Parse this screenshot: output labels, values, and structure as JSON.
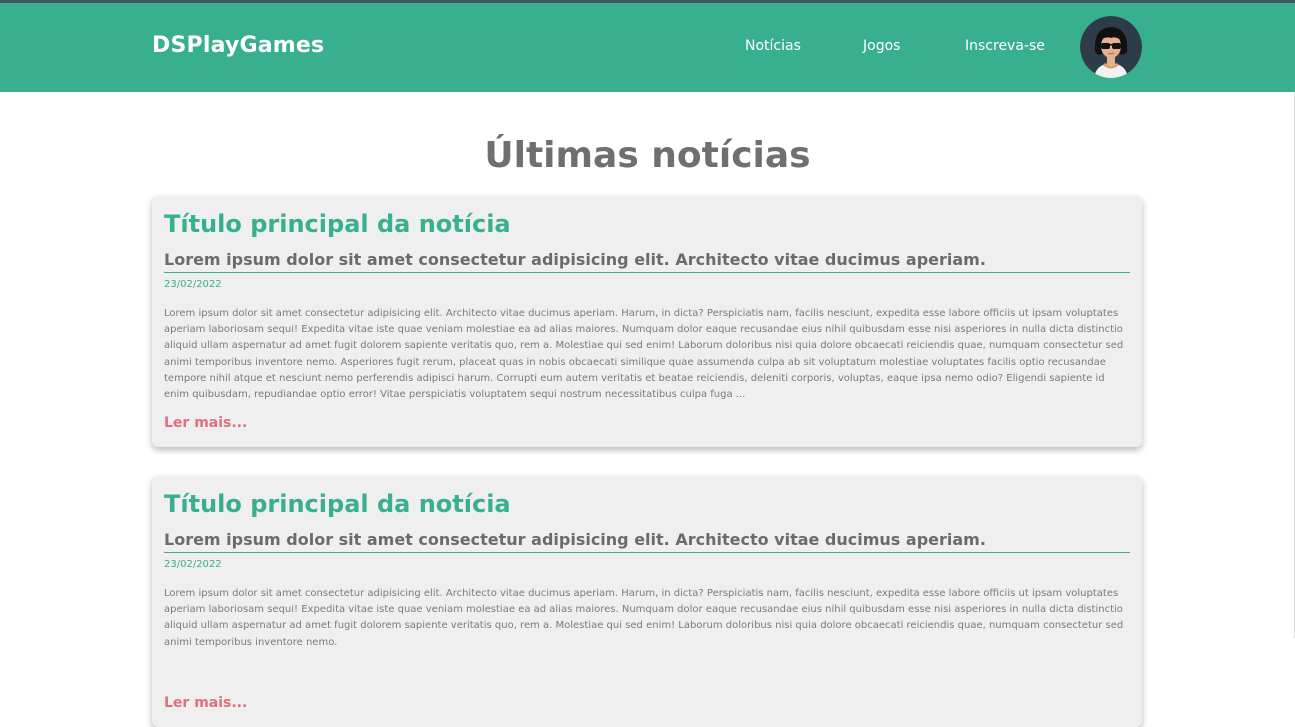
{
  "header": {
    "brand": "DSPlayGames",
    "nav": {
      "noticias": "Notícias",
      "jogos": "Jogos",
      "inscreva": "Inscreva-se"
    },
    "accent_color": "#38b08f"
  },
  "main": {
    "title": "Últimas notícias",
    "articles": [
      {
        "title": "Título principal da notícia",
        "subtitle": "Lorem ipsum dolor sit amet consectetur adipisicing elit. Architecto vitae ducimus aperiam.",
        "date": "23/02/2022",
        "body": "Lorem ipsum dolor sit amet consectetur adipisicing elit. Architecto vitae ducimus aperiam. Harum, in dicta? Perspiciatis nam, facilis nesciunt, expedita esse labore officiis ut ipsam voluptates aperiam laboriosam sequi! Expedita vitae iste quae veniam molestiae ea ad alias maiores. Numquam dolor eaque recusandae eius nihil quibusdam esse nisi asperiores in nulla dicta distinctio aliquid ullam aspernatur ad amet fugit dolorem sapiente veritatis quo, rem a. Molestiae qui sed enim! Laborum doloribus nisi quia dolore obcaecati reiciendis quae, numquam consectetur sed animi temporibus inventore nemo. Asperiores fugit rerum, placeat quas in nobis obcaecati similique quae assumenda culpa ab sit voluptatum molestiae voluptates facilis optio recusandae tempore nihil atque et nesciunt nemo perferendis adipisci harum. Corrupti eum autem veritatis et beatae reiciendis, deleniti corporis, voluptas, eaque ipsa nemo odio? Eligendi sapiente id enim quibusdam, repudiandae optio error! Vitae perspiciatis voluptatem sequi nostrum necessitatibus culpa fuga ...",
        "more": "Ler mais..."
      },
      {
        "title": "Título principal da notícia",
        "subtitle": "Lorem ipsum dolor sit amet consectetur adipisicing elit. Architecto vitae ducimus aperiam.",
        "date": "23/02/2022",
        "body": "Lorem ipsum dolor sit amet consectetur adipisicing elit. Architecto vitae ducimus aperiam. Harum, in dicta? Perspiciatis nam, facilis nesciunt, expedita esse labore officiis ut ipsam voluptates aperiam laboriosam sequi! Expedita vitae iste quae veniam molestiae ea ad alias maiores. Numquam dolor eaque recusandae eius nihil quibusdam esse nisi asperiores in nulla dicta distinctio aliquid ullam aspernatur ad amet fugit dolorem sapiente veritatis quo, rem a. Molestiae qui sed enim! Laborum doloribus nisi quia dolore obcaecati reiciendis quae, numquam consectetur sed animi temporibus inventore nemo.",
        "more": "Ler mais..."
      }
    ]
  }
}
